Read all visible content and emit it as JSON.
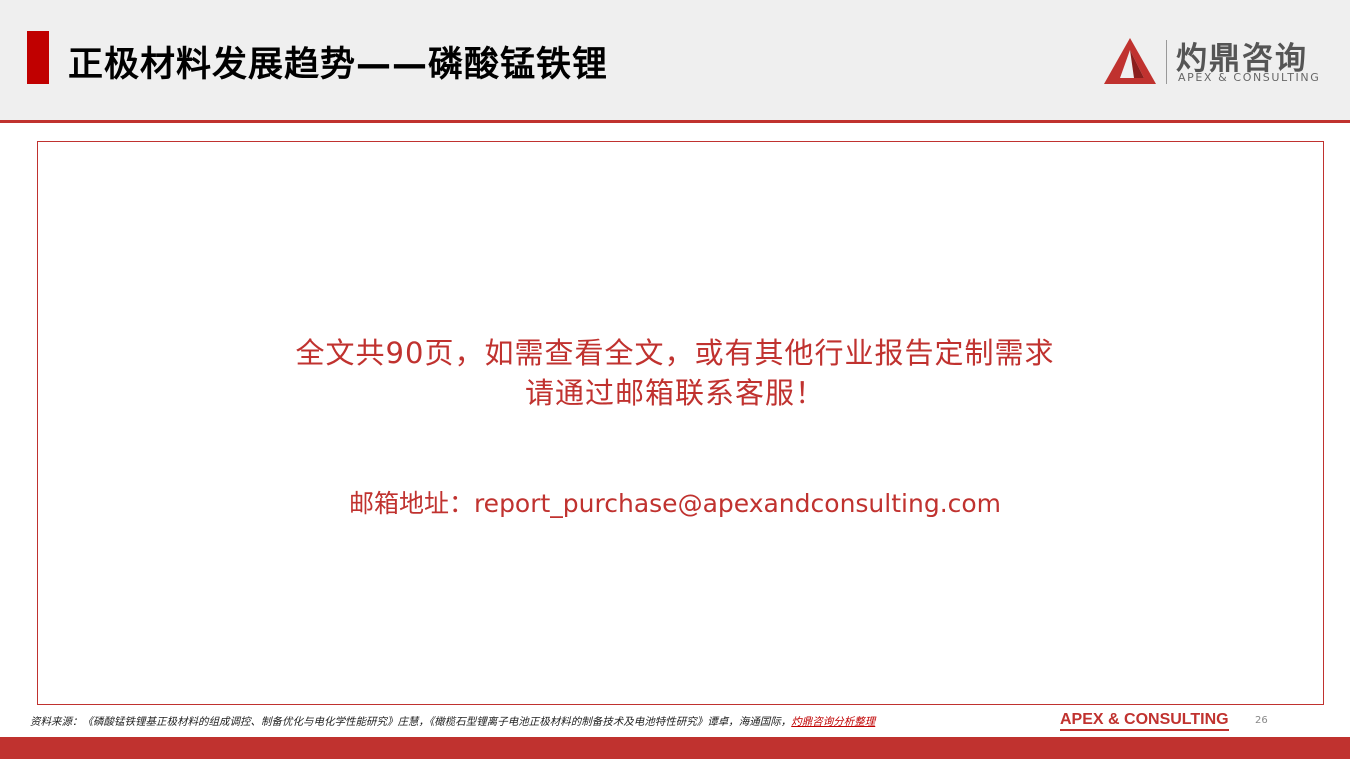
{
  "header": {
    "title": "正极材料发展趋势——磷酸锰铁锂",
    "logo_cn": "灼鼎咨询",
    "logo_en": "APEX & CONSULTING"
  },
  "main": {
    "line1": "全文共90页，如需查看全文，或有其他行业报告定制需求",
    "line2": "请通过邮箱联系客服！",
    "email_line": "邮箱地址：report_purchase@apexandconsulting.com"
  },
  "footer": {
    "source_text": "资料来源：《磷酸锰铁锂基正极材料的组成调控、制备优化与电化学性能研究》庄慧，《橄榄石型锂离子电池正极材料的制备技术及电池特性研究》谭卓，海通国际，",
    "source_highlight": "灼鼎咨询分析整理",
    "brand": "APEX & CONSULTING",
    "page_number": "26"
  },
  "colors": {
    "accent_red": "#c0322f",
    "title_bar_red": "#c00000",
    "header_bg": "#efefef"
  }
}
